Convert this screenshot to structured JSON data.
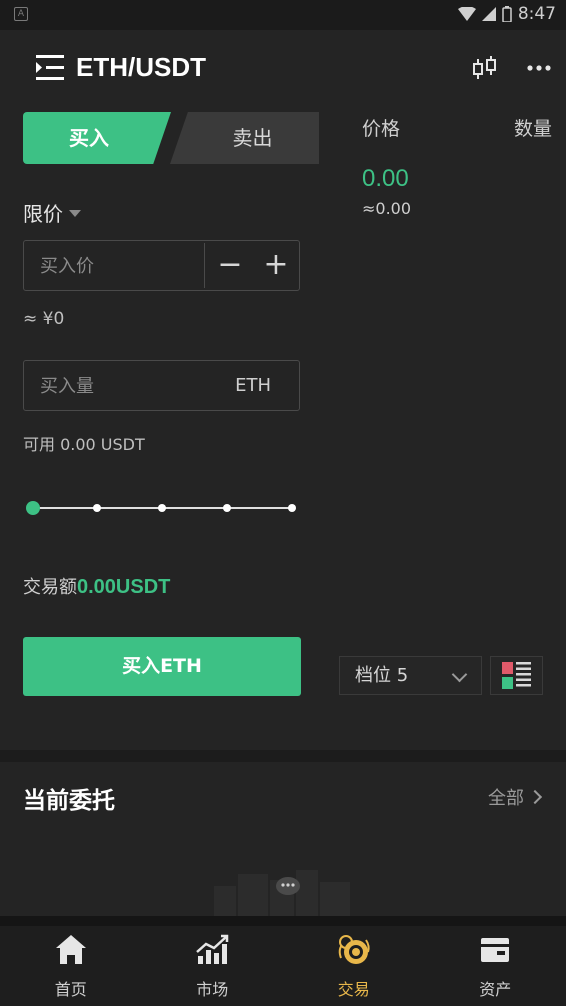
{
  "status_bar": {
    "time": "8:47"
  },
  "header": {
    "pair": "ETH/USDT"
  },
  "trade_tabs": {
    "buy": "买入",
    "sell": "卖出"
  },
  "order_book": {
    "price_header": "价格",
    "qty_header": "数量",
    "last_price": "0.00",
    "last_price_approx": "≈0.00"
  },
  "order_form": {
    "order_type": "限价",
    "price_placeholder": "买入价",
    "minus": "−",
    "plus": "+",
    "price_cny": "≈ ¥0",
    "qty_placeholder": "买入量",
    "qty_unit": "ETH",
    "available": "可用 0.00 USDT",
    "slider_percent": 0,
    "amount_label": "交易额",
    "amount_value": "0.00USDT",
    "submit_label": "买入ETH"
  },
  "depth": {
    "label": "档位 5"
  },
  "orders": {
    "title": "当前委托",
    "all_label": "全部"
  },
  "nav": {
    "items": [
      {
        "label": "首页",
        "icon": "home-icon"
      },
      {
        "label": "市场",
        "icon": "market-chart-icon"
      },
      {
        "label": "交易",
        "icon": "trade-coins-icon",
        "active": true
      },
      {
        "label": "资产",
        "icon": "wallet-icon"
      }
    ]
  },
  "colors": {
    "accent": "#3dc185",
    "nav_active": "#e8b74a",
    "background": "#242424"
  }
}
